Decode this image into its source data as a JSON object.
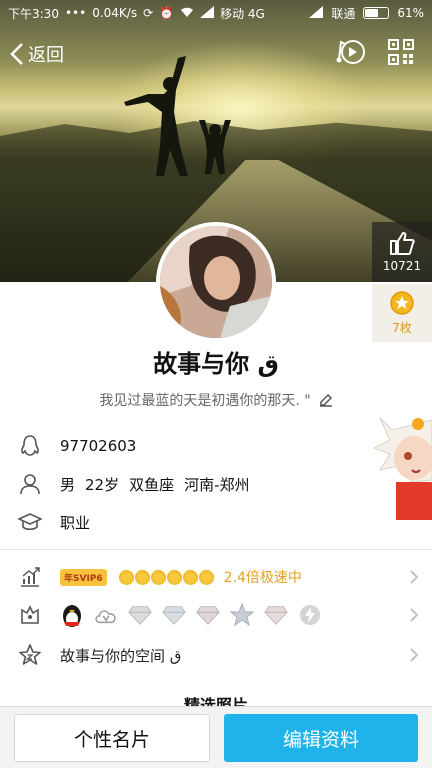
{
  "status_bar": {
    "time": "下午3:30",
    "dots": "•••",
    "speed": "0.04K/s",
    "carrier1": "移动 4G",
    "carrier2": "联通",
    "battery": "61%",
    "battery_level": 0.61
  },
  "nav": {
    "back_label": "返回",
    "icons": [
      "music-icon",
      "qr-code-icon"
    ]
  },
  "side": {
    "like_count": "10721",
    "gift_count": "7枚"
  },
  "profile": {
    "name": "故事与你",
    "name_suffix": "ق",
    "signature": "我见过最蓝的天是初遇你的那天. \""
  },
  "info": {
    "qq": "97702603",
    "gender": "男",
    "age": "22岁",
    "zodiac": "双鱼座",
    "location": "河南-郑州",
    "job": "职业"
  },
  "vip": {
    "badge": "年SVIP6",
    "speed_text": "2.4倍极速中"
  },
  "services": {
    "icons": [
      "penguin-icon",
      "cloud-v-icon",
      "diamond-icon",
      "diamond-icon",
      "diamond-icon",
      "star-icon",
      "diamond-icon",
      "lightning-icon"
    ]
  },
  "space": {
    "label": "故事与你的空间 ق"
  },
  "peek_heading": "精选照片",
  "buttons": {
    "card": "个性名片",
    "edit": "编辑资料"
  },
  "colors": {
    "accent_blue": "#20b3ea",
    "gold": "#e4a120"
  }
}
